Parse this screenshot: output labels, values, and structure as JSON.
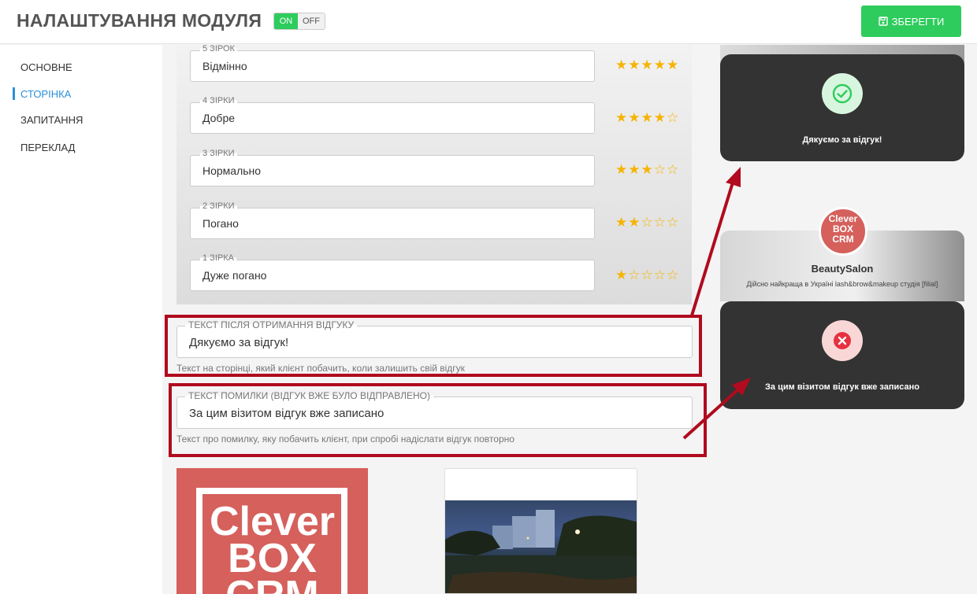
{
  "header": {
    "title": "НАЛАШТУВАННЯ МОДУЛЯ",
    "toggle_on": "ON",
    "toggle_off": "OFF",
    "save_label": "ЗБЕРЕГТИ"
  },
  "sidebar": {
    "items": [
      {
        "label": "ОСНОВНЕ"
      },
      {
        "label": "СТОРІНКА"
      },
      {
        "label": "ЗАПИТАННЯ"
      },
      {
        "label": "ПЕРЕКЛАД"
      }
    ],
    "active": "СТОРІНКА"
  },
  "ratings": [
    {
      "label": "5 ЗІРОК",
      "value": "Відмінно",
      "stars": "★★★★★",
      "stars_count": 5
    },
    {
      "label": "4 ЗІРКИ",
      "value": "Добре",
      "stars": "★★★★☆",
      "stars_count": 4
    },
    {
      "label": "3 ЗІРКИ",
      "value": "Нормально",
      "stars": "★★★☆☆",
      "stars_count": 3
    },
    {
      "label": "2 ЗІРКИ",
      "value": "Погано",
      "stars": "★★☆☆☆",
      "stars_count": 2
    },
    {
      "label": "1 ЗІРКА",
      "value": "Дуже погано",
      "stars": "★☆☆☆☆",
      "stars_count": 1
    }
  ],
  "success_text": {
    "label": "ТЕКСТ ПІСЛЯ ОТРИМАННЯ ВІДГУКУ",
    "value": "Дякуємо за відгук!",
    "hint": "Текст на сторінці, який клієнт побачить, коли залишить свій відгук"
  },
  "error_text": {
    "label": "ТЕКСТ ПОМИЛКИ (ВІДГУК ВЖЕ БУЛО ВІДПРАВЛЕНО)",
    "value": "За цим візитом відгук вже записано",
    "hint": "Текст про помилку, яку побачить клієнт, при спробі надіслати відгук повторно"
  },
  "logo": {
    "line1": "Clever",
    "line2": "BOX",
    "line3": "CRM"
  },
  "preview": {
    "success_message": "Дякуємо за відгук!",
    "error_message": "За цим візитом відгук вже записано",
    "salon_name": "BeautySalon",
    "salon_description": "Дійсно найкраща в Україні lash&brow&makeup студія [filial]"
  },
  "colors": {
    "accent_green": "#2ecc5c",
    "accent_blue": "#2b8fd8",
    "highlight_red": "#b00b1e",
    "star": "#f6b400",
    "popup_dark": "#333333",
    "brand_red": "#d5605c"
  },
  "icons": {
    "save": "save-disk-icon",
    "success": "check-circle-icon",
    "error": "x-circle-icon"
  }
}
